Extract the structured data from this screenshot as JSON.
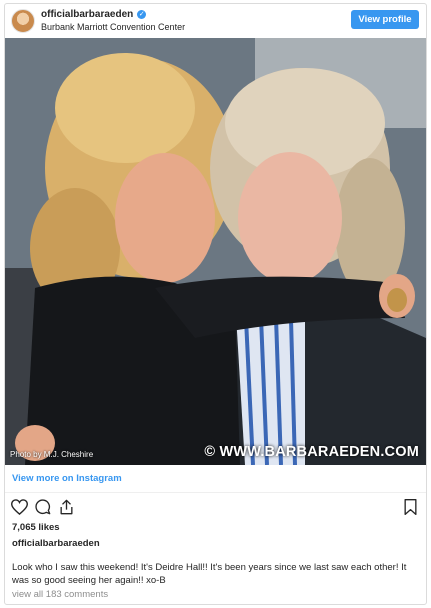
{
  "header": {
    "username": "officialbarbaraeden",
    "location": "Burbank Marriott Convention Center",
    "view_profile_label": "View profile"
  },
  "photo": {
    "credit": "Photo by M.J. Cheshire",
    "watermark": "© WWW.BARBARAEDEN.COM"
  },
  "view_more_label": "View more on Instagram",
  "actions": {
    "icons": [
      "heart-icon",
      "comment-icon",
      "share-icon",
      "bookmark-icon"
    ]
  },
  "likes": "7,065 likes",
  "caption": {
    "author": "officialbarbaraeden",
    "text": "Look who I saw this weekend! It's Deidre Hall!! It's been years since we last saw each other! It was so good seeing her again!! xo-B"
  },
  "comments_label": "view all 183 comments",
  "colors": {
    "accent": "#3897f0",
    "text": "#262626",
    "muted": "#8e8e8e",
    "border": "#dbdbdb"
  }
}
